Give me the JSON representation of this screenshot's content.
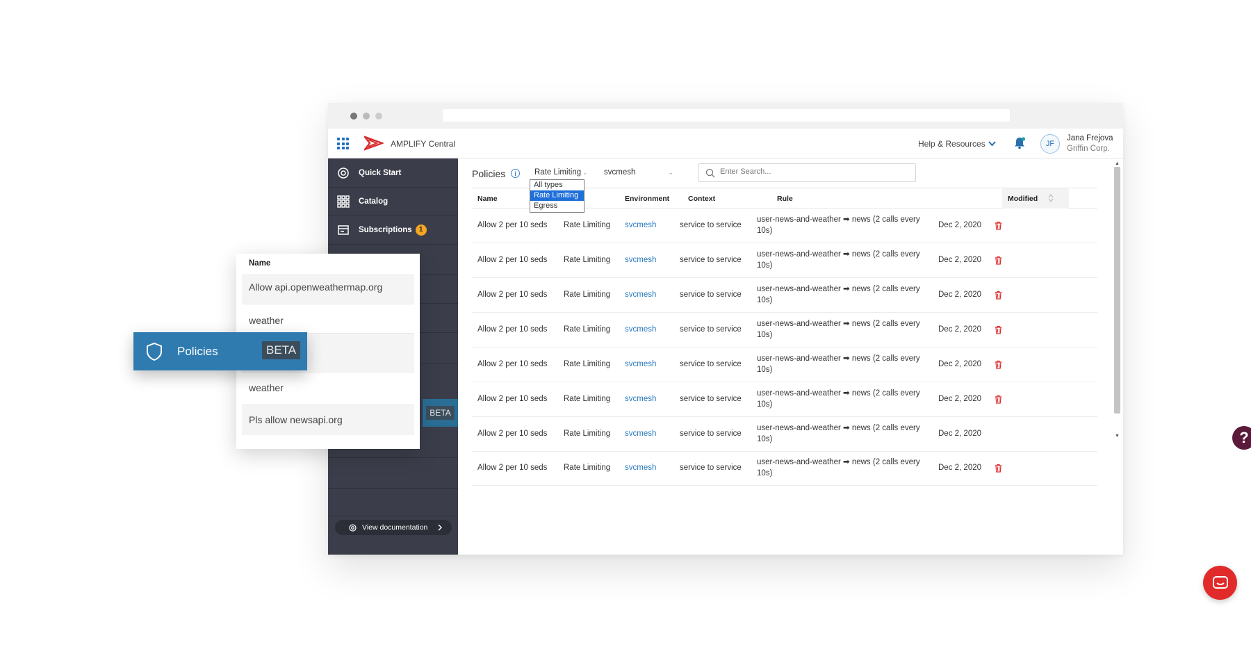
{
  "header": {
    "app_title": "AMPLIFY Central",
    "help_label": "Help & Resources",
    "user_initials": "JF",
    "user_name": "Jana Frejova",
    "user_org": "Griffin Corp."
  },
  "sidebar": {
    "items": [
      {
        "label": "Quick Start",
        "icon": "gear-icon"
      },
      {
        "label": "Catalog",
        "icon": "grid-icon"
      },
      {
        "label": "Subscriptions",
        "icon": "subscriptions-icon",
        "badge": "1"
      }
    ],
    "beta_label": "BETA",
    "view_doc_label": "View documentation"
  },
  "main": {
    "title": "Policies",
    "filter_type": "Rate Limiting",
    "filter_env": "svcmesh",
    "search_placeholder": "Enter Search...",
    "type_options": [
      "All types",
      "Rate Limiting",
      "Egress"
    ],
    "type_selected": "Rate Limiting",
    "columns": [
      "Name",
      "Environment",
      "Context",
      "Rule",
      "Modified"
    ],
    "rows": [
      {
        "name": "Allow 2 per 10 seds",
        "type": "Rate Limiting",
        "env": "svcmesh",
        "context": "service to service",
        "rule": "user-news-and-weather ➡ news (2 calls every 10s)",
        "modified": "Dec 2, 2020",
        "trash": true
      },
      {
        "name": "Allow 2 per 10 seds",
        "type": "Rate Limiting",
        "env": "svcmesh",
        "context": "service to service",
        "rule": "user-news-and-weather ➡ news (2 calls every 10s)",
        "modified": "Dec 2, 2020",
        "trash": true
      },
      {
        "name": "Allow 2 per 10 seds",
        "type": "Rate Limiting",
        "env": "svcmesh",
        "context": "service to service",
        "rule": "user-news-and-weather ➡ news (2 calls every 10s)",
        "modified": "Dec 2, 2020",
        "trash": true
      },
      {
        "name": "Allow 2 per 10 seds",
        "type": "Rate Limiting",
        "env": "svcmesh",
        "context": "service to service",
        "rule": "user-news-and-weather ➡ news (2 calls every 10s)",
        "modified": "Dec 2, 2020",
        "trash": true
      },
      {
        "name": "Allow 2 per 10 seds",
        "type": "Rate Limiting",
        "env": "svcmesh",
        "context": "service to service",
        "rule": "user-news-and-weather ➡ news (2 calls every 10s)",
        "modified": "Dec 2, 2020",
        "trash": true
      },
      {
        "name": "Allow 2 per 10 seds",
        "type": "Rate Limiting",
        "env": "svcmesh",
        "context": "service to service",
        "rule": "user-news-and-weather ➡ news (2 calls every 10s)",
        "modified": "Dec 2, 2020",
        "trash": true
      },
      {
        "name": "Allow 2 per 10 seds",
        "type": "Rate Limiting",
        "env": "svcmesh",
        "context": "service to service",
        "rule": "user-news-and-weather ➡ news (2 calls every 10s)",
        "modified": "Dec 2, 2020",
        "trash": false
      },
      {
        "name": "Allow 2 per 10 seds",
        "type": "Rate Limiting",
        "env": "svcmesh",
        "context": "service to service",
        "rule": "user-news-and-weather ➡ news (2 calls every 10s)",
        "modified": "Dec 2, 2020",
        "trash": true
      }
    ]
  },
  "overlay": {
    "header": "Name",
    "items": [
      "Allow api.openweathermap.org",
      "weather",
      "",
      "weather",
      "Pls allow newsapi.org"
    ]
  },
  "policies_tag": {
    "label": "Policies",
    "beta": "BETA"
  },
  "colors": {
    "sidebar_bg": "#3b3e4a",
    "accent_blue": "#2f7bb0",
    "link_blue": "#2a7abf",
    "danger_red": "#e12b2b",
    "badge_orange": "#f5a623"
  }
}
